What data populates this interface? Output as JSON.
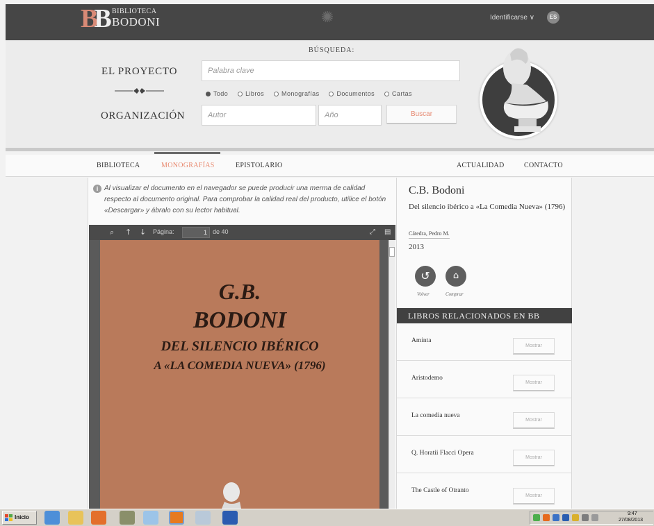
{
  "header": {
    "logo_top": "BIBLIOTECA",
    "logo_bottom": "BODONI",
    "login": "Identificarse ∨",
    "language": "ES"
  },
  "search": {
    "label": "BÚSQUEDA:",
    "project_link": "EL PROYECTO",
    "organization_link": "ORGANIZACIÓN",
    "keyword_placeholder": "Palabra clave",
    "author_placeholder": "Autor",
    "year_placeholder": "Año",
    "button": "Buscar",
    "filters": [
      {
        "label": "Todo",
        "selected": true
      },
      {
        "label": "Libros",
        "selected": false
      },
      {
        "label": "Monografías",
        "selected": false
      },
      {
        "label": "Documentos",
        "selected": false
      },
      {
        "label": "Cartas",
        "selected": false
      }
    ]
  },
  "nav": {
    "biblioteca": "BIBLIOTECA",
    "monografias": "MONOGRAFÍAS",
    "epistolario": "EPISTOLARIO",
    "actualidad": "ACTUALIDAD",
    "contacto": "CONTACTO",
    "active": "MONOGRAFÍAS",
    "active_color": "#e8896f"
  },
  "viewer": {
    "notice": "Al visualizar el documento en el navegador se puede producir una merma de calidad respecto al documento original. Para comprobar la calidad real del producto, utilice el botón «Descargar» y ábralo con su lector habitual.",
    "page_label": "Página:",
    "page_current": "1",
    "page_total": "de 40",
    "doc_line1": "G.B.",
    "doc_line2": "BODONI",
    "doc_line3": "DEL SILENCIO IBÉRICO",
    "doc_line4": "A «LA COMEDIA NUEVA» (1796)"
  },
  "book": {
    "author": "C.B. Bodoni",
    "title": "Del silencio ibérico a «La Comedia Nueva» (1796)",
    "editor": "Cátedra, Pedro M.",
    "year": "2013",
    "back_label": "Volver",
    "buy_label": "Comprar"
  },
  "related": {
    "heading": "LIBROS RELACIONADOS EN BB",
    "show_label": "Mostrar",
    "items": [
      "Aminta",
      "Aristodemo",
      "La comedia nueva",
      "Q. Horatii Flacci Opera",
      "The Castle of Otranto"
    ]
  },
  "taskbar": {
    "start": "Inicio",
    "time": "9:47",
    "date": "27/08/2013",
    "icons": [
      "ie-icon",
      "folder-icon",
      "media-icon",
      "paint-icon",
      "notepad-icon",
      "firefox-icon",
      "home-icon",
      "word-icon"
    ]
  }
}
